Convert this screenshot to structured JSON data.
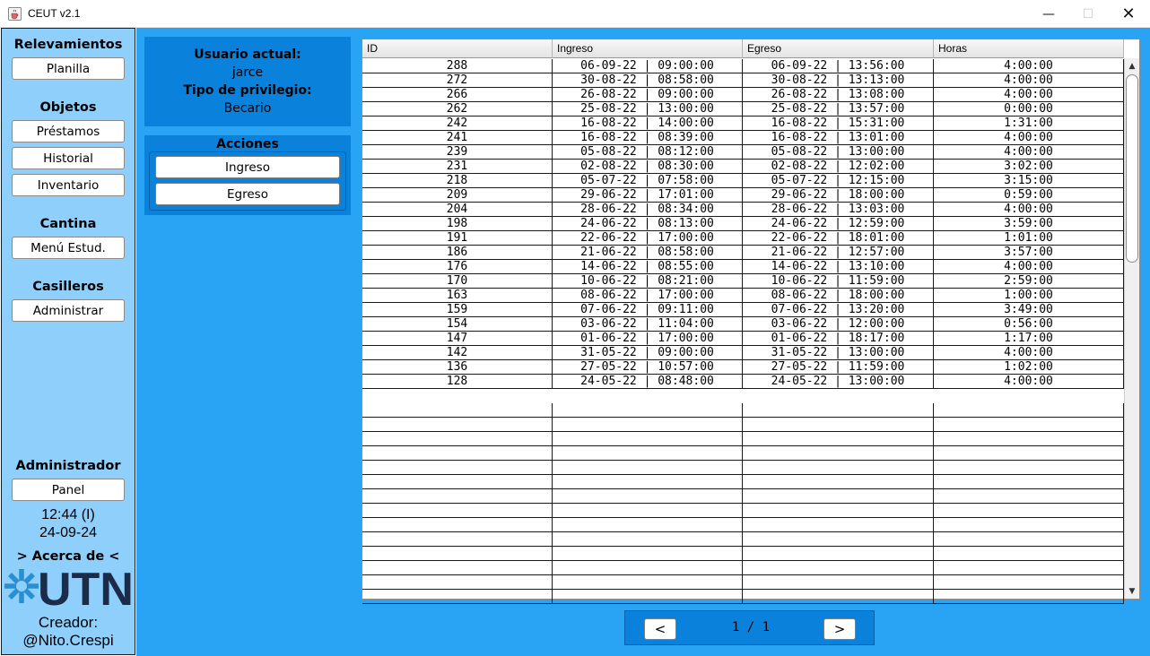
{
  "window": {
    "title": "CEUT v2.1",
    "controls": {
      "minimize": "—",
      "maximize": "☐",
      "close": "✕"
    }
  },
  "sidebar": {
    "relevamientos": {
      "heading": "Relevamientos",
      "buttons": [
        "Planilla"
      ]
    },
    "objetos": {
      "heading": "Objetos",
      "buttons": [
        "Préstamos",
        "Historial",
        "Inventario"
      ]
    },
    "cantina": {
      "heading": "Cantina",
      "buttons": [
        "Menú Estud."
      ]
    },
    "casilleros": {
      "heading": "Casilleros",
      "buttons": [
        "Administrar"
      ]
    },
    "administrador": {
      "heading": "Administrador",
      "buttons": [
        "Panel"
      ]
    },
    "clock": {
      "time": "12:44 (I)",
      "date": "24-09-24"
    },
    "about": "> Acerca de <",
    "logo_text": "UTN",
    "creator": {
      "label": "Creador:",
      "handle": "@Nito.Crespi"
    }
  },
  "user": {
    "current_user_label": "Usuario actual:",
    "current_user": "jarce",
    "privilege_label": "Tipo de privilegio:",
    "privilege": "Becario"
  },
  "actions": {
    "title": "Acciones",
    "ingreso": "Ingreso",
    "egreso": "Egreso"
  },
  "table": {
    "columns": [
      "ID",
      "Ingreso",
      "Egreso",
      "Horas"
    ],
    "rows": [
      [
        "288",
        "06-09-22 | 09:00:00",
        "06-09-22 | 13:56:00",
        "4:00:00"
      ],
      [
        "272",
        "30-08-22 | 08:58:00",
        "30-08-22 | 13:13:00",
        "4:00:00"
      ],
      [
        "266",
        "26-08-22 | 09:00:00",
        "26-08-22 | 13:08:00",
        "4:00:00"
      ],
      [
        "262",
        "25-08-22 | 13:00:00",
        "25-08-22 | 13:57:00",
        "0:00:00"
      ],
      [
        "242",
        "16-08-22 | 14:00:00",
        "16-08-22 | 15:31:00",
        "1:31:00"
      ],
      [
        "241",
        "16-08-22 | 08:39:00",
        "16-08-22 | 13:01:00",
        "4:00:00"
      ],
      [
        "239",
        "05-08-22 | 08:12:00",
        "05-08-22 | 13:00:00",
        "4:00:00"
      ],
      [
        "231",
        "02-08-22 | 08:30:00",
        "02-08-22 | 12:02:00",
        "3:02:00"
      ],
      [
        "218",
        "05-07-22 | 07:58:00",
        "05-07-22 | 12:15:00",
        "3:15:00"
      ],
      [
        "209",
        "29-06-22 | 17:01:00",
        "29-06-22 | 18:00:00",
        "0:59:00"
      ],
      [
        "204",
        "28-06-22 | 08:34:00",
        "28-06-22 | 13:03:00",
        "4:00:00"
      ],
      [
        "198",
        "24-06-22 | 08:13:00",
        "24-06-22 | 12:59:00",
        "3:59:00"
      ],
      [
        "191",
        "22-06-22 | 17:00:00",
        "22-06-22 | 18:01:00",
        "1:01:00"
      ],
      [
        "186",
        "21-06-22 | 08:58:00",
        "21-06-22 | 12:57:00",
        "3:57:00"
      ],
      [
        "176",
        "14-06-22 | 08:55:00",
        "14-06-22 | 13:10:00",
        "4:00:00"
      ],
      [
        "170",
        "10-06-22 | 08:21:00",
        "10-06-22 | 11:59:00",
        "2:59:00"
      ],
      [
        "163",
        "08-06-22 | 17:00:00",
        "08-06-22 | 18:00:00",
        "1:00:00"
      ],
      [
        "159",
        "07-06-22 | 09:11:00",
        "07-06-22 | 13:20:00",
        "3:49:00"
      ],
      [
        "154",
        "03-06-22 | 11:04:00",
        "03-06-22 | 12:00:00",
        "0:56:00"
      ],
      [
        "147",
        "01-06-22 | 17:00:00",
        "01-06-22 | 18:17:00",
        "1:17:00"
      ],
      [
        "142",
        "31-05-22 | 09:00:00",
        "31-05-22 | 13:00:00",
        "4:00:00"
      ],
      [
        "136",
        "27-05-22 | 10:57:00",
        "27-05-22 | 11:59:00",
        "1:02:00"
      ],
      [
        "128",
        "24-05-22 | 08:48:00",
        "24-05-22 | 13:00:00",
        "4:00:00"
      ]
    ]
  },
  "pagination": {
    "prev": "<",
    "next": ">",
    "indicator": "1 / 1"
  },
  "colors": {
    "sidebar_bg": "#8fcffb",
    "main_bg": "#29a3f3",
    "panel_bg": "#0a81da"
  },
  "icons": [
    "java-cup-icon",
    "utn-logo",
    "scroll-up-icon",
    "scroll-down-icon"
  ]
}
